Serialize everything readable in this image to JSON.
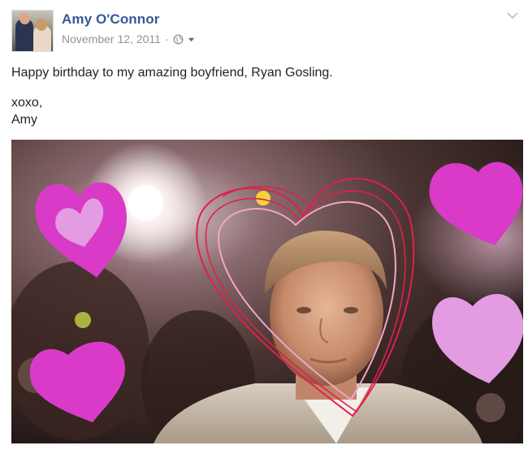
{
  "post": {
    "author": "Amy O'Connor",
    "date": "November 12, 2011",
    "separator": "·",
    "audience_icon": "globe-icon",
    "audience_caret_icon": "caret-down-icon",
    "options_icon": "chevron-down-icon",
    "message_line1": "Happy birthday to my amazing boyfriend, Ryan Gosling.",
    "message_line2": "xoxo,",
    "message_line3": "Amy"
  },
  "colors": {
    "author_link": "#365899",
    "meta_gray": "#90949c",
    "heart_magenta": "#d93bc8",
    "heart_pink": "#e39be1",
    "scribble_red": "#e0204a"
  }
}
